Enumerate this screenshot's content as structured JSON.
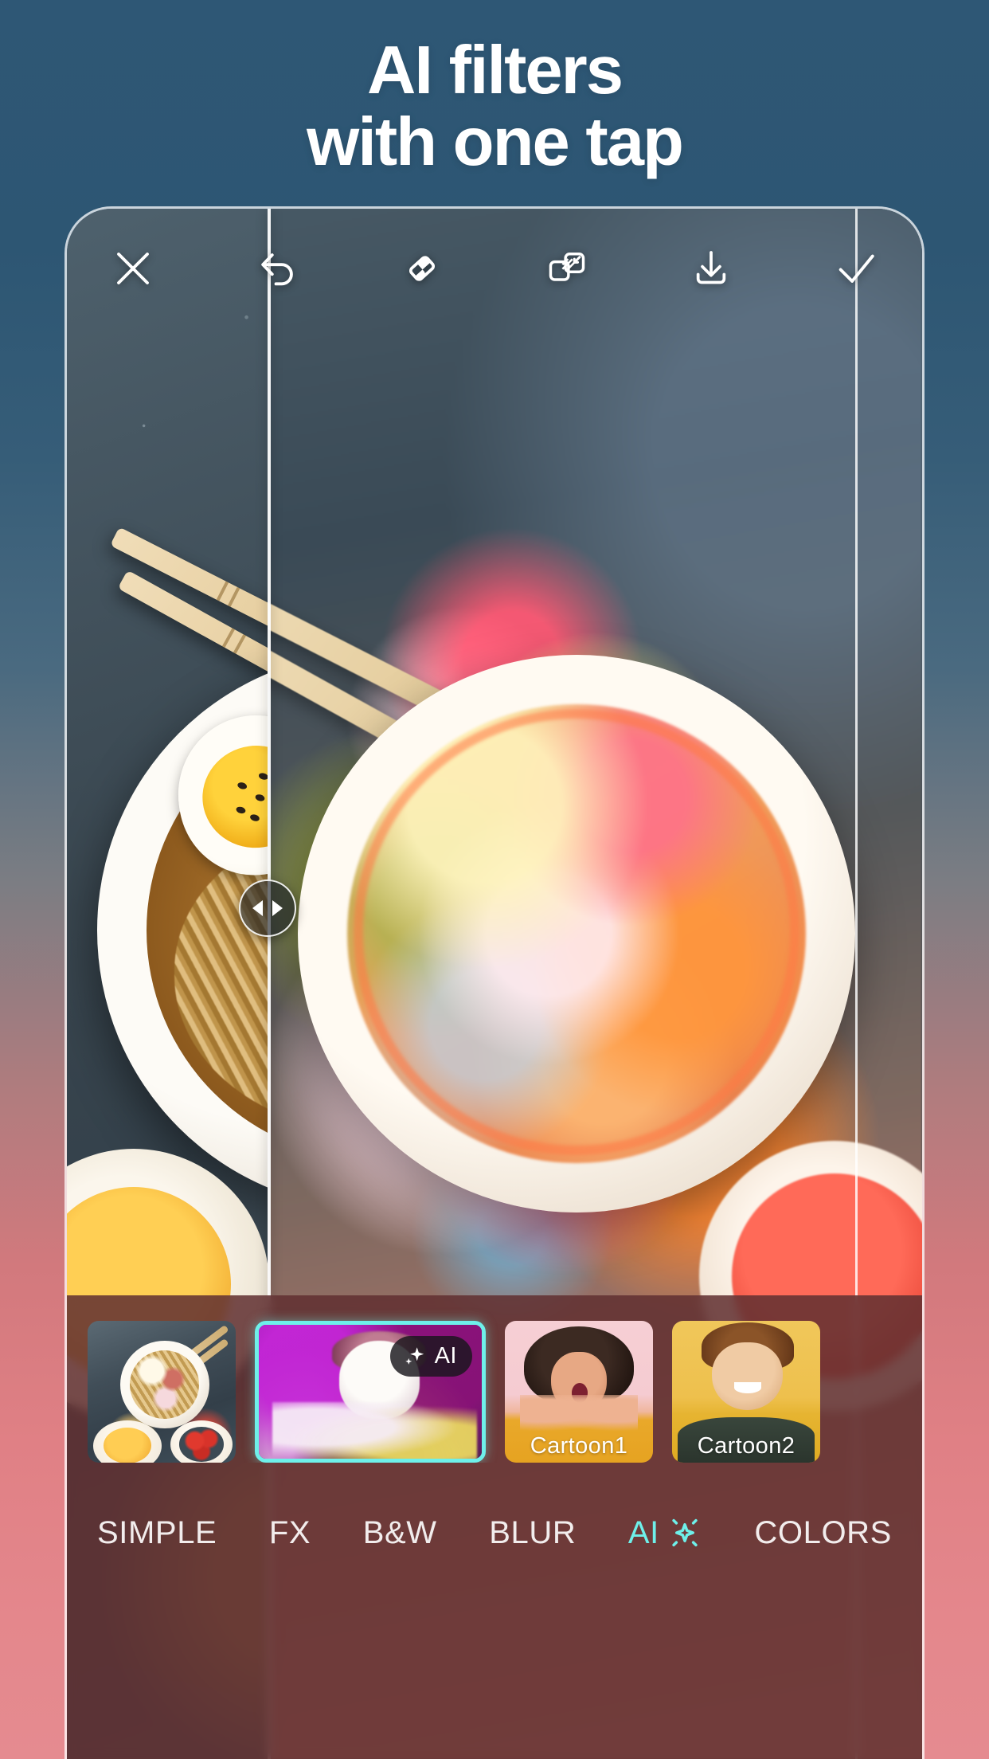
{
  "headline": {
    "line1": "AI filters",
    "line2": "with one tap"
  },
  "colors": {
    "background_top": "#2e5775",
    "background_bottom": "#e58b90",
    "accent_cyan": "#6ef0ea",
    "panel": "rgba(97,48,49,0.86)"
  },
  "toolbar": {
    "buttons": [
      {
        "name": "close-icon",
        "label": "Close"
      },
      {
        "name": "undo-icon",
        "label": "Undo"
      },
      {
        "name": "eraser-icon",
        "label": "Eraser"
      },
      {
        "name": "compare-icon",
        "label": "Compare layers"
      },
      {
        "name": "download-icon",
        "label": "Save"
      },
      {
        "name": "check-icon",
        "label": "Apply"
      }
    ]
  },
  "compare_slider": {
    "position_percent": 23.5,
    "handle_icon": "left-right-arrows-icon"
  },
  "filter_strip": {
    "items": [
      {
        "id": "original",
        "label": "",
        "selected": false,
        "badge": ""
      },
      {
        "id": "ai-art",
        "label": "",
        "selected": true,
        "badge": "AI"
      },
      {
        "id": "cartoon1",
        "label": "Cartoon1",
        "selected": false,
        "badge": ""
      },
      {
        "id": "cartoon2",
        "label": "Cartoon2",
        "selected": false,
        "badge": ""
      }
    ]
  },
  "tabs": {
    "items": [
      {
        "id": "simple",
        "label": "SIMPLE",
        "active": false,
        "has_sparkle": false
      },
      {
        "id": "fx",
        "label": "FX",
        "active": false,
        "has_sparkle": false
      },
      {
        "id": "bw",
        "label": "B&W",
        "active": false,
        "has_sparkle": false
      },
      {
        "id": "blur",
        "label": "BLUR",
        "active": false,
        "has_sparkle": false
      },
      {
        "id": "ai",
        "label": "AI",
        "active": true,
        "has_sparkle": true
      },
      {
        "id": "colors",
        "label": "COLORS",
        "active": false,
        "has_sparkle": false
      }
    ]
  }
}
